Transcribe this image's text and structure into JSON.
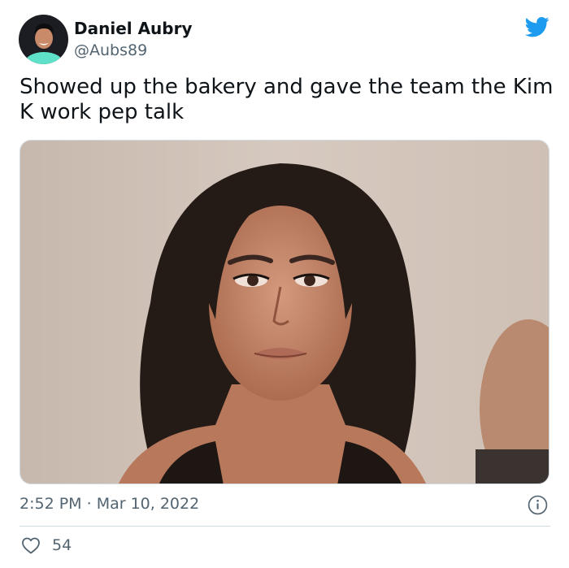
{
  "author": {
    "display_name": "Daniel Aubry",
    "handle": "@Aubs89",
    "avatar_icon": "profile-avatar"
  },
  "tweet": {
    "text": "Showed up the bakery and gave the team the Kim K work pep talk",
    "media_icon": "attached-photo"
  },
  "meta": {
    "time": "2:52 PM",
    "separator": " · ",
    "date": "Mar 10, 2022",
    "likes": "54"
  },
  "icons": {
    "brand": "twitter-bird-icon",
    "info": "info-icon",
    "like": "heart-icon"
  },
  "colors": {
    "brand": "#1d9bf0",
    "text_primary": "#0f1419",
    "text_secondary": "#536471",
    "divider": "#cfd9de"
  }
}
